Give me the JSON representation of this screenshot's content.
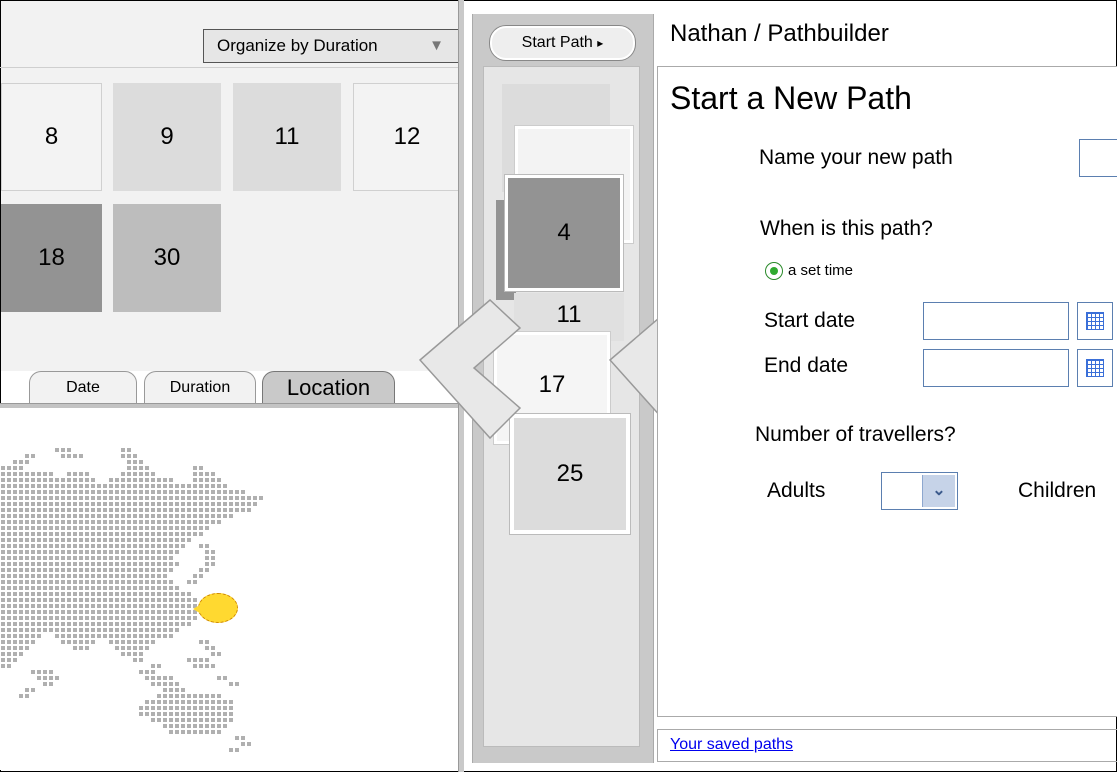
{
  "left_pane": {
    "organize_label": "Organize by Duration",
    "organize_arrow": "▼",
    "duration_tiles": [
      "8",
      "9",
      "11",
      "12",
      "18",
      "30"
    ],
    "tabs": [
      {
        "label": "Date",
        "active": false
      },
      {
        "label": "Duration",
        "active": false
      },
      {
        "label": "Location",
        "active": true
      }
    ]
  },
  "middle": {
    "start_path_label": "Start Path",
    "start_path_arrow": "▸",
    "stack": [
      "4",
      "11",
      "17",
      "25"
    ]
  },
  "right_pane": {
    "breadcrumb": "Nathan / Pathbuilder",
    "title": "Start a New Path",
    "name_label": "Name your new path",
    "when_label": "When is this path?",
    "radio_label": "a set time",
    "start_date_label": "Start date",
    "end_date_label": "End date",
    "travellers_label": "Number of travellers?",
    "adults_label": "Adults",
    "children_label": "Children",
    "saved_paths_link": "Your saved paths"
  },
  "colors": {
    "map_dots": "#b0b0b0",
    "pin": "#ffd930",
    "link": "#0000ee",
    "input_border": "#5b7fb0"
  }
}
